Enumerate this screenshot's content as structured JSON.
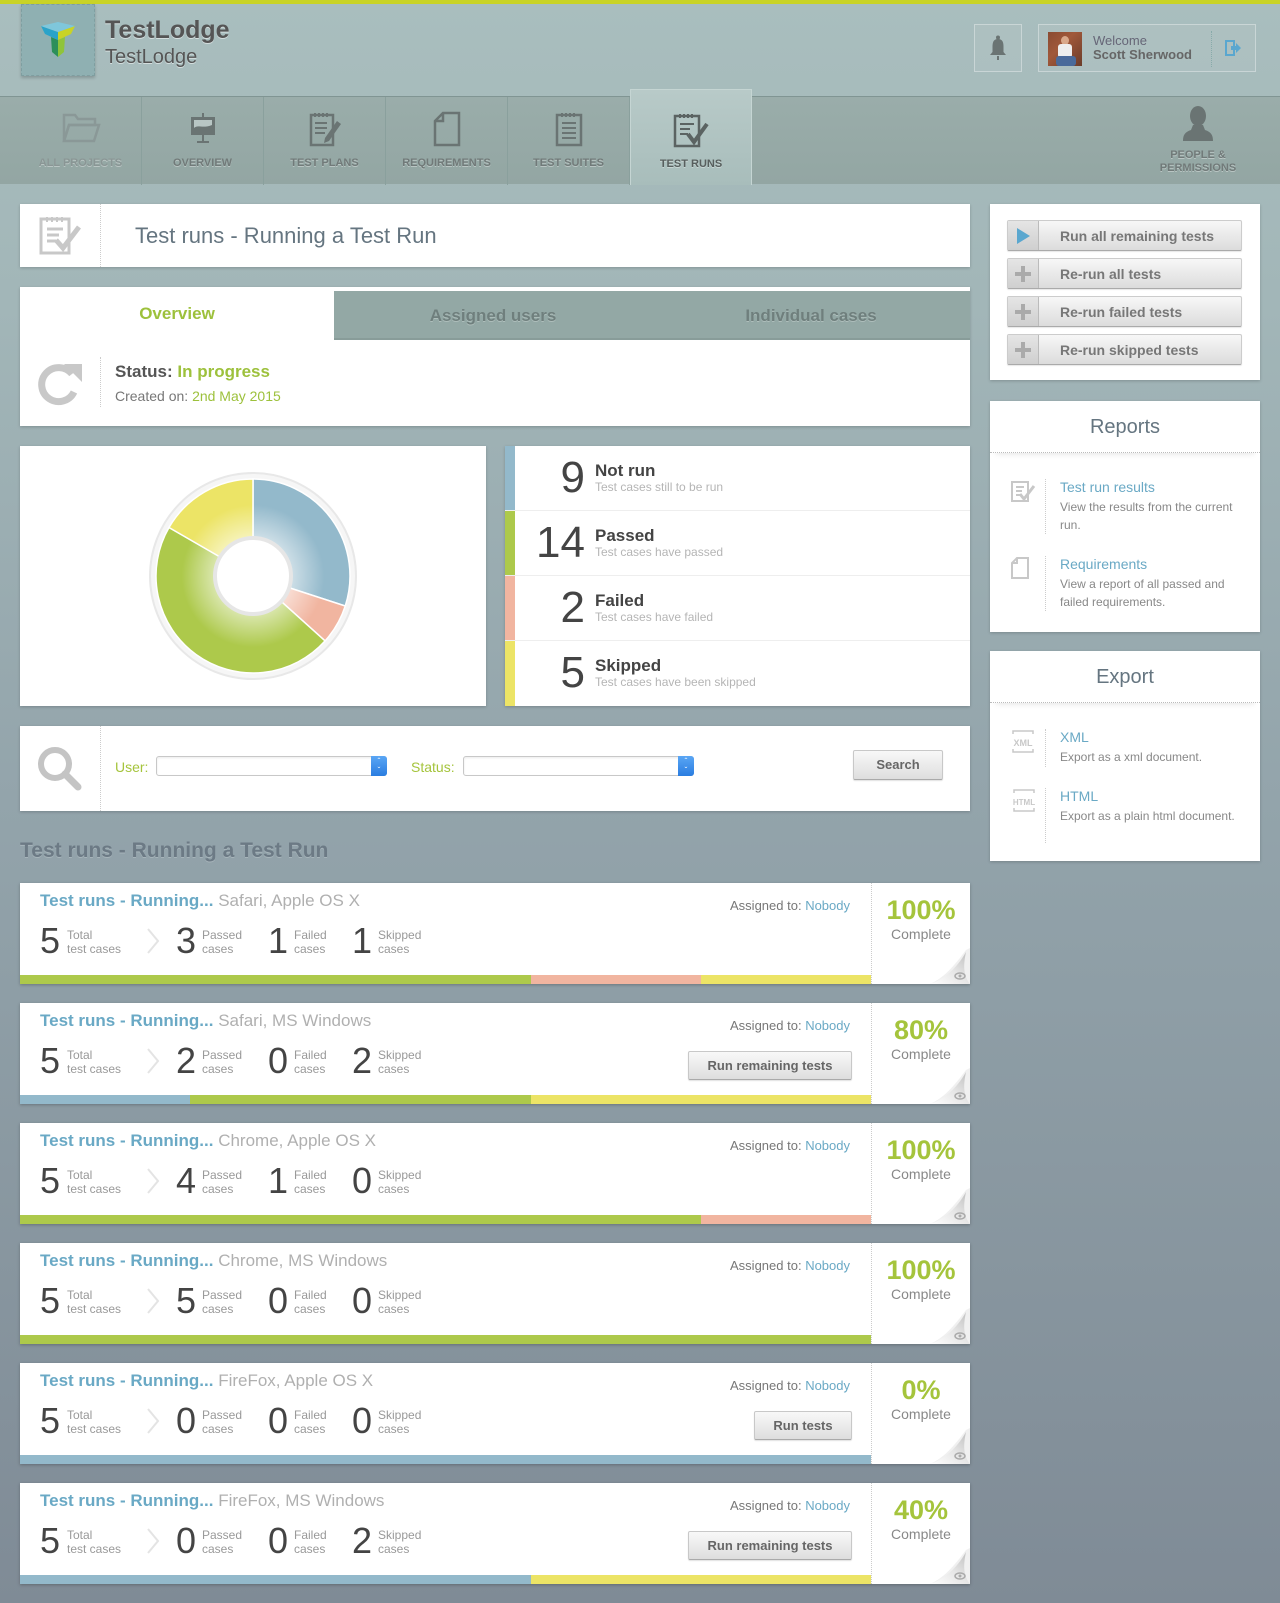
{
  "app": {
    "name": "TestLodge",
    "project": "TestLodge",
    "accent_color": "#c9d326"
  },
  "user": {
    "welcome": "Welcome",
    "name": "Scott Sherwood"
  },
  "nav": {
    "items": [
      {
        "label": "ALL PROJECTS",
        "icon": "folder-icon"
      },
      {
        "label": "OVERVIEW",
        "icon": "presentation-icon"
      },
      {
        "label": "TEST PLANS",
        "icon": "notepad-pencil-icon"
      },
      {
        "label": "REQUIREMENTS",
        "icon": "document-icon"
      },
      {
        "label": "TEST SUITES",
        "icon": "notepad-icon"
      },
      {
        "label": "TEST RUNS",
        "icon": "notepad-check-icon",
        "active": true
      }
    ],
    "people": "PEOPLE & PERMISSIONS"
  },
  "page": {
    "title": "Test runs - Running a Test Run"
  },
  "tabs": [
    {
      "label": "Overview",
      "active": true
    },
    {
      "label": "Assigned users"
    },
    {
      "label": "Individual cases"
    }
  ],
  "status": {
    "label": "Status:",
    "value": "In progress",
    "created_label": "Created on:",
    "created_value": "2nd May 2015"
  },
  "summary": [
    {
      "count": "9",
      "name": "Not run",
      "desc": "Test cases still to be run",
      "color": "#93b9cb"
    },
    {
      "count": "14",
      "name": "Passed",
      "desc": "Test cases have passed",
      "color": "#adc94b"
    },
    {
      "count": "2",
      "name": "Failed",
      "desc": "Test cases have failed",
      "color": "#f1b5a0"
    },
    {
      "count": "5",
      "name": "Skipped",
      "desc": "Test cases have been skipped",
      "color": "#ece466"
    }
  ],
  "chart_data": {
    "type": "pie",
    "style": "donut",
    "title": "",
    "slices": [
      {
        "label": "Not run",
        "value": 9,
        "color": "#93b9cb"
      },
      {
        "label": "Failed",
        "value": 2,
        "color": "#f1b5a0"
      },
      {
        "label": "Passed",
        "value": 14,
        "color": "#adc94b"
      },
      {
        "label": "Skipped",
        "value": 5,
        "color": "#ece466"
      }
    ],
    "legend": "none"
  },
  "filters": {
    "user_label": "User:",
    "user_value": "",
    "status_label": "Status:",
    "status_value": "",
    "search_button": "Search"
  },
  "list": {
    "heading": "Test runs - Running a Test Run",
    "labels": {
      "assigned": "Assigned to:",
      "total_top": "Total",
      "total_bottom": "test cases",
      "passed_top": "Passed",
      "failed_top": "Failed",
      "skipped_top": "Skipped",
      "cases": "cases",
      "complete": "Complete"
    },
    "runs": [
      {
        "link": "Test runs - Running...",
        "env": "Safari, Apple OS X",
        "assigned": "Nobody",
        "total": "5",
        "passed": "3",
        "failed": "1",
        "skipped": "1",
        "percent": "100%",
        "button": "",
        "progress": {
          "not_run": 0,
          "passed": 3,
          "failed": 1,
          "skipped": 1
        }
      },
      {
        "link": "Test runs - Running...",
        "env": "Safari, MS Windows",
        "assigned": "Nobody",
        "total": "5",
        "passed": "2",
        "failed": "0",
        "skipped": "2",
        "percent": "80%",
        "button": "Run remaining tests",
        "progress": {
          "not_run": 1,
          "passed": 2,
          "failed": 0,
          "skipped": 2
        }
      },
      {
        "link": "Test runs - Running...",
        "env": "Chrome, Apple OS X",
        "assigned": "Nobody",
        "total": "5",
        "passed": "4",
        "failed": "1",
        "skipped": "0",
        "percent": "100%",
        "button": "",
        "progress": {
          "not_run": 0,
          "passed": 4,
          "failed": 1,
          "skipped": 0
        }
      },
      {
        "link": "Test runs - Running...",
        "env": "Chrome, MS Windows",
        "assigned": "Nobody",
        "total": "5",
        "passed": "5",
        "failed": "0",
        "skipped": "0",
        "percent": "100%",
        "button": "",
        "progress": {
          "not_run": 0,
          "passed": 5,
          "failed": 0,
          "skipped": 0
        }
      },
      {
        "link": "Test runs - Running...",
        "env": "FireFox, Apple OS X",
        "assigned": "Nobody",
        "total": "5",
        "passed": "0",
        "failed": "0",
        "skipped": "0",
        "percent": "0%",
        "button": "Run tests",
        "progress": {
          "not_run": 5,
          "passed": 0,
          "failed": 0,
          "skipped": 0
        }
      },
      {
        "link": "Test runs - Running...",
        "env": "FireFox, MS Windows",
        "assigned": "Nobody",
        "total": "5",
        "passed": "0",
        "failed": "0",
        "skipped": "2",
        "percent": "40%",
        "button": "Run remaining tests",
        "progress": {
          "not_run": 3,
          "passed": 0,
          "failed": 0,
          "skipped": 2
        }
      }
    ]
  },
  "actions": [
    {
      "label": "Run all remaining tests",
      "icon": "play-icon"
    },
    {
      "label": "Re-run all tests",
      "icon": "plus-icon"
    },
    {
      "label": "Re-run failed tests",
      "icon": "plus-icon"
    },
    {
      "label": "Re-run skipped tests",
      "icon": "plus-icon"
    }
  ],
  "reports": {
    "heading": "Reports",
    "items": [
      {
        "title": "Test run results",
        "desc": "View the results from the current run."
      },
      {
        "title": "Requirements",
        "desc": "View a report of all passed and failed requirements."
      }
    ]
  },
  "export": {
    "heading": "Export",
    "items": [
      {
        "title": "XML",
        "desc": "Export as a xml document.",
        "icon_text": "XML"
      },
      {
        "title": "HTML",
        "desc": "Export as a plain html document.",
        "icon_text": "HTML"
      }
    ]
  }
}
